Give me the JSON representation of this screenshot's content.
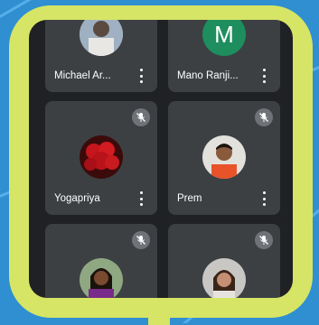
{
  "participants": [
    {
      "name": "Michael Ar...",
      "avatar_icon": "photo-avatar-icon",
      "muted": false
    },
    {
      "name": "Mano Ranji...",
      "avatar_letter": "M",
      "avatar_color": "#1e8e5f",
      "muted": false
    },
    {
      "name": "Yogapriya",
      "avatar_icon": "roses-photo-icon",
      "muted": true
    },
    {
      "name": "Prem",
      "avatar_icon": "photo-avatar-icon",
      "muted": true
    },
    {
      "name": "",
      "avatar_icon": "photo-avatar-icon",
      "muted": true
    },
    {
      "name": "",
      "avatar_icon": "photo-avatar-icon",
      "muted": true
    }
  ],
  "colors": {
    "tile_bg": "#3c4043",
    "screen_bg": "#202124",
    "frame": "#d6e565",
    "background": "#2f8fd0"
  },
  "icons": {
    "menu": "more-vert-icon",
    "mic_off": "mic-off-icon"
  }
}
